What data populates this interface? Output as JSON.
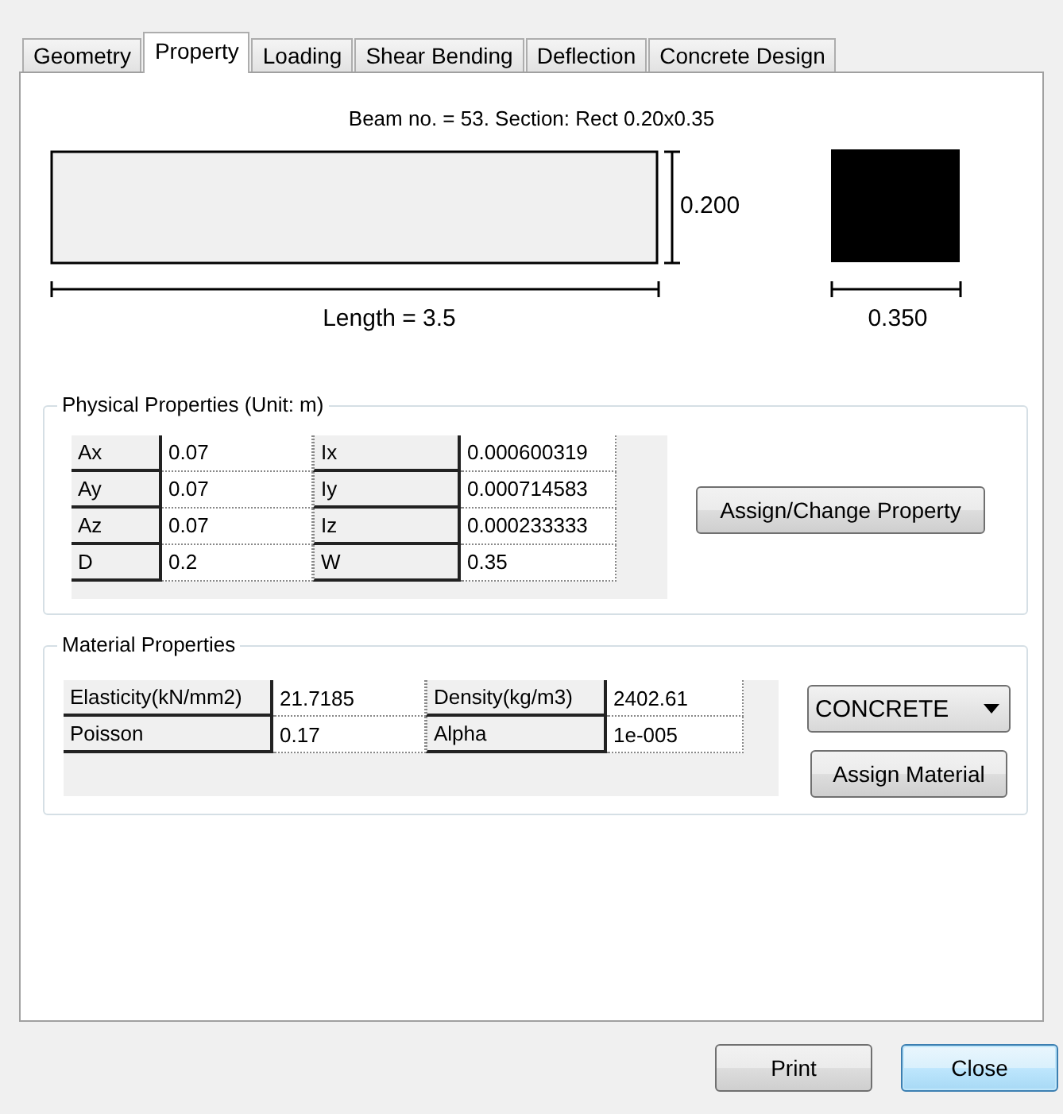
{
  "tabs": [
    {
      "label": "Geometry",
      "selected": false
    },
    {
      "label": "Property",
      "selected": true
    },
    {
      "label": "Loading",
      "selected": false
    },
    {
      "label": "Shear Bending",
      "selected": false
    },
    {
      "label": "Deflection",
      "selected": false
    },
    {
      "label": "Concrete Design",
      "selected": false
    }
  ],
  "header": "Beam no. = 53. Section: Rect 0.20x0.35",
  "beam_drawing": {
    "depth_label": "0.200",
    "length_label": "Length = 3.5",
    "width_label": "0.350"
  },
  "physical_properties": {
    "title": "Physical Properties (Unit: m)",
    "rows": [
      [
        "Ax",
        "0.07",
        "Ix",
        "0.000600319"
      ],
      [
        "Ay",
        "0.07",
        "Iy",
        "0.000714583"
      ],
      [
        "Az",
        "0.07",
        "Iz",
        "0.000233333"
      ],
      [
        "D",
        "0.2",
        "W",
        "0.35"
      ]
    ],
    "button": "Assign/Change Property"
  },
  "material_properties": {
    "title": "Material Properties",
    "rows": [
      [
        "Elasticity(kN/mm2)",
        "21.7185",
        "Density(kg/m3)",
        "2402.61"
      ],
      [
        "Poisson",
        "0.17",
        "Alpha",
        "1e-005"
      ]
    ],
    "dropdown": {
      "value": "CONCRETE"
    },
    "button": "Assign Material"
  },
  "buttons": [
    {
      "label": "Print",
      "focused": false
    },
    {
      "label": "Close",
      "focused": true
    }
  ]
}
